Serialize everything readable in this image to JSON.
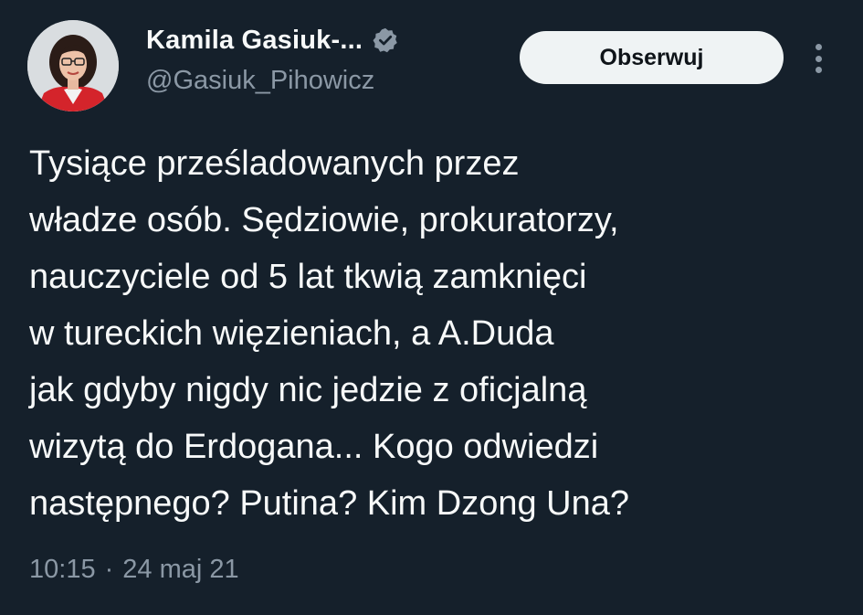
{
  "author": {
    "display_name": "Kamila Gasiuk-...",
    "handle": "@Gasiuk_Pihowicz",
    "verified_icon": "verified-badge-icon"
  },
  "actions": {
    "follow_label": "Obserwuj",
    "more_icon": "more-options-icon"
  },
  "tweet": {
    "lines": [
      "Tysiące prześladowanych przez",
      "władze osób. Sędziowie, prokuratorzy,",
      "nauczyciele od 5 lat tkwią zamknięci",
      "w tureckich więzieniach, a A.Duda",
      "jak gdyby nigdy nic jedzie z oficjalną",
      "wizytą do Erdogana... Kogo odwiedzi",
      "następnego? Putina? Kim Dzong Una?"
    ],
    "time": "10:15",
    "separator": "·",
    "date": "24 maj 21"
  },
  "colors": {
    "background": "#15202b",
    "text": "#f7f9f9",
    "secondary_text": "#8b98a5",
    "follow_button_bg": "#eff3f4"
  }
}
